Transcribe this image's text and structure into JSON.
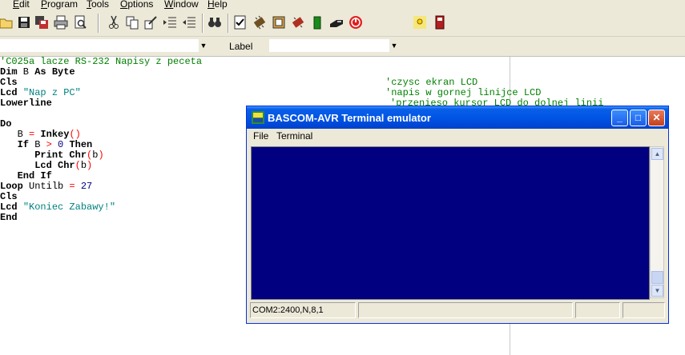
{
  "menubar": {
    "items": [
      {
        "label": "Edit",
        "accel": "E"
      },
      {
        "label": "Program",
        "accel": "P"
      },
      {
        "label": "Tools",
        "accel": "T"
      },
      {
        "label": "Options",
        "accel": "O"
      },
      {
        "label": "Window",
        "accel": "W"
      },
      {
        "label": "Help",
        "accel": "H"
      }
    ]
  },
  "comborow": {
    "label_text": "Label",
    "label_accel": "L"
  },
  "code": {
    "lines": [
      "'C025a lacze RS-232 Napisy z peceta",
      "Dim B As Byte",
      "Cls",
      "Lcd \"Nap z PC\"",
      "Lowerline",
      "",
      "Do",
      "   B = Inkey()",
      "   If B > 0 Then",
      "      Print Chr(b)",
      "      Lcd Chr(b)",
      "   End If",
      "Loop Untilb = 27",
      "Cls",
      "Lcd \"Koniec Zabawy!\"",
      "End"
    ],
    "comments": {
      "cls": "'czysc ekran LCD",
      "lcd": "'napis w gornej linijce LCD",
      "lowerline": "'przenieso kursor LCD do dolnej linii"
    }
  },
  "terminal": {
    "title": "BASCOM-AVR Terminal emulator",
    "menu": [
      "File",
      "Terminal"
    ],
    "status": "COM2:2400,N,8,1",
    "screen_color": "#000080"
  }
}
